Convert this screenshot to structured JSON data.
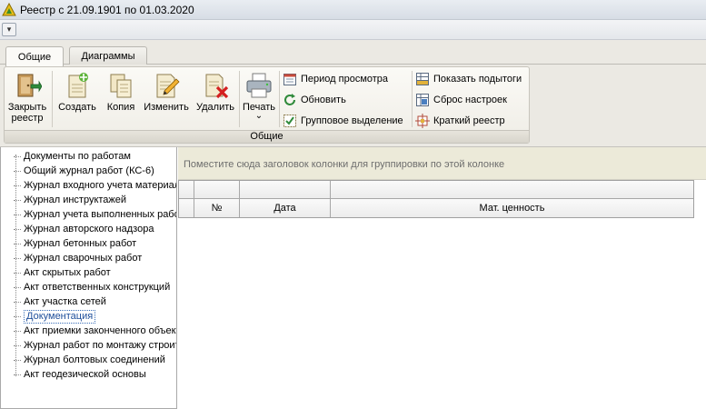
{
  "window": {
    "title": "Реестр с 21.09.1901 по 01.03.2020"
  },
  "quick_access": {
    "menu_glyph": "▾"
  },
  "tabs": [
    {
      "label": "Общие",
      "active": true
    },
    {
      "label": "Диаграммы",
      "active": false
    }
  ],
  "ribbon": {
    "group_label": "Общие",
    "big_buttons": {
      "close": {
        "line1": "Закрыть",
        "line2": "реестр",
        "icon": "door-exit-icon"
      },
      "create": {
        "label": "Создать",
        "icon": "new-document-icon"
      },
      "copy": {
        "label": "Копия",
        "icon": "copy-documents-icon"
      },
      "edit": {
        "label": "Изменить",
        "icon": "edit-pencil-icon"
      },
      "delete": {
        "label": "Удалить",
        "icon": "delete-document-icon"
      },
      "print": {
        "label": "Печать",
        "arrow": "⌄",
        "icon": "printer-icon"
      }
    },
    "small_buttons": {
      "period": {
        "label": "Период просмотра",
        "icon": "calendar-icon"
      },
      "refresh": {
        "label": "Обновить",
        "icon": "refresh-icon"
      },
      "group_select": {
        "label": "Групповое выделение",
        "icon": "checklist-icon"
      },
      "subtotals": {
        "label": "Показать подытоги",
        "icon": "subtotals-icon"
      },
      "reset": {
        "label": "Сброс настроек",
        "icon": "reset-settings-icon"
      },
      "short_registry": {
        "label": "Краткий реестр",
        "icon": "short-registry-icon"
      }
    }
  },
  "tree": {
    "items": [
      "Документы по работам",
      "Общий журнал работ (КС-6)",
      "Журнал входного учета материалов",
      "Журнал инструктажей",
      "Журнал учета выполненных работ",
      "Журнал авторского надзора",
      "Журнал бетонных работ",
      "Журнал сварочных работ",
      "Акт скрытых работ",
      "Акт ответственных конструкций",
      "Акт участка сетей",
      "Документация",
      "Акт приемки законченного объекта",
      "Журнал работ по монтажу строительных",
      "Журнал болтовых соединений",
      "Акт геодезической основы"
    ],
    "selected": "Документация"
  },
  "grid": {
    "group_panel_hint": "Поместите сюда заголовок колонки для группировки по этой колонке",
    "columns": [
      "№",
      "Дата",
      "Мат. ценность"
    ]
  },
  "colors": {
    "ribbon_bg": "#ebe9e3",
    "group_panel_bg": "#ecead9",
    "selection_border": "#3a6fb7"
  }
}
